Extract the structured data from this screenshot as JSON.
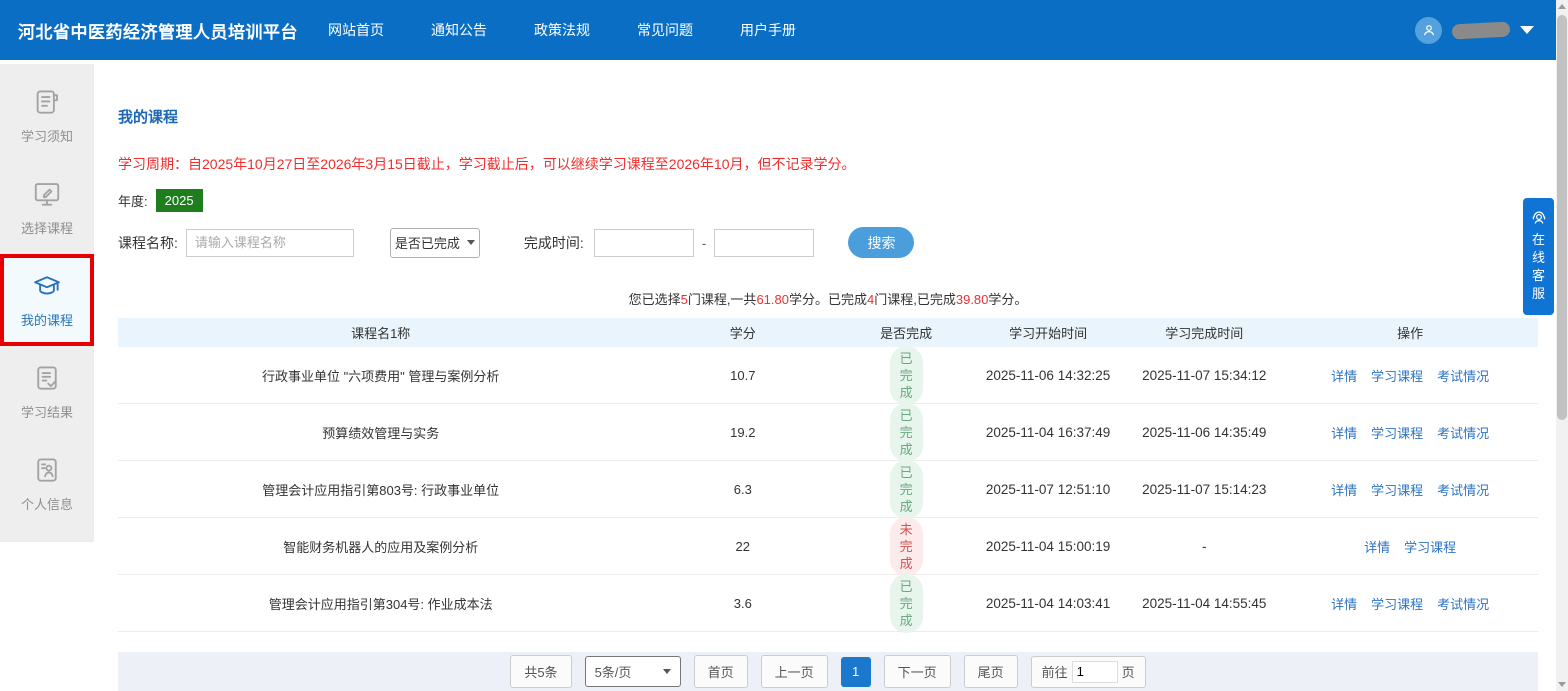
{
  "topbar": {
    "title": "河北省中医药经济管理人员培训平台",
    "nav": [
      "网站首页",
      "通知公告",
      "政策法规",
      "常见问题",
      "用户手册"
    ]
  },
  "sidebar": {
    "items": [
      {
        "label": "学习须知"
      },
      {
        "label": "选择课程"
      },
      {
        "label": "我的课程"
      },
      {
        "label": "学习结果"
      },
      {
        "label": "个人信息"
      }
    ]
  },
  "main": {
    "page_title": "我的课程",
    "notice": "学习周期：自2025年10月27日至2026年3月15日截止，学习截止后，可以继续学习课程至2026年10月，但不记录学分。",
    "year_label": "年度:",
    "year_value": "2025",
    "filters": {
      "course_name_label": "课程名称:",
      "course_name_placeholder": "请输入课程名称",
      "completed_select": "是否已完成",
      "finish_time_label": "完成时间:",
      "range_separator": "-",
      "search_button": "搜索"
    },
    "summary": {
      "parts": [
        "您已选择",
        "5",
        "门课程,一共",
        "61.80",
        "学分。已完成",
        "4",
        "门课程,已完成",
        "39.80",
        "学分。"
      ]
    },
    "table": {
      "headers": [
        "课程名1称",
        "学分",
        "是否完成",
        "学习开始时间",
        "学习完成时间",
        "操作"
      ],
      "rows": [
        {
          "name": "行政事业单位 \"六项费用\" 管理与案例分析",
          "credit": "10.7",
          "status": "已完成",
          "status_type": "done",
          "start": "2025-11-06 14:32:25",
          "end": "2025-11-07 15:34:12",
          "actions": [
            "详情",
            "学习课程",
            "考试情况"
          ]
        },
        {
          "name": "预算绩效管理与实务",
          "credit": "19.2",
          "status": "已完成",
          "status_type": "done",
          "start": "2025-11-04 16:37:49",
          "end": "2025-11-06 14:35:49",
          "actions": [
            "详情",
            "学习课程",
            "考试情况"
          ]
        },
        {
          "name": "管理会计应用指引第803号: 行政事业单位",
          "credit": "6.3",
          "status": "已完成",
          "status_type": "done",
          "start": "2025-11-07 12:51:10",
          "end": "2025-11-07 15:14:23",
          "actions": [
            "详情",
            "学习课程",
            "考试情况"
          ]
        },
        {
          "name": "智能财务机器人的应用及案例分析",
          "credit": "22",
          "status": "未完成",
          "status_type": "undone",
          "start": "2025-11-04 15:00:19",
          "end": "-",
          "actions": [
            "详情",
            "学习课程"
          ]
        },
        {
          "name": "管理会计应用指引第304号: 作业成本法",
          "credit": "3.6",
          "status": "已完成",
          "status_type": "done",
          "start": "2025-11-04 14:03:41",
          "end": "2025-11-04 14:55:45",
          "actions": [
            "详情",
            "学习课程",
            "考试情况"
          ]
        }
      ]
    },
    "pagination": {
      "total": "共5条",
      "page_size": "5条/页",
      "first": "首页",
      "prev": "上一页",
      "current": "1",
      "next": "下一页",
      "last": "尾页",
      "goto_prefix": "前往",
      "goto_value": "1",
      "goto_suffix": "页"
    }
  },
  "service": {
    "label": "在线客服"
  },
  "colors": {
    "topbar_blue": "#0a6fc4",
    "link_blue": "#2d74c4",
    "notice_red": "#f02e2e",
    "year_badge_green": "#1e7e1e",
    "done_bg": "#e7f5ec",
    "done_text": "#68a980",
    "undone_bg": "#fdeaea",
    "undone_text": "#d05454",
    "active_page_blue": "#1b79cd",
    "search_button_blue": "#4a9edc",
    "active_highlight_red": "#e60000"
  }
}
